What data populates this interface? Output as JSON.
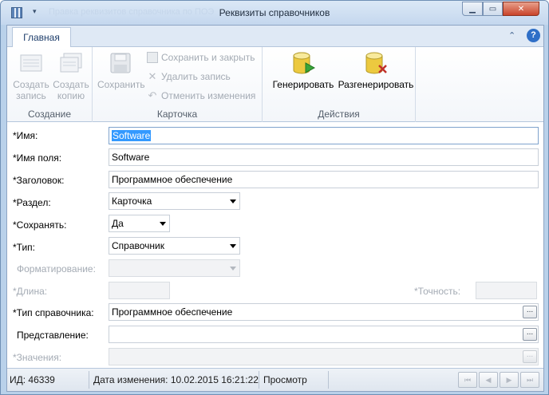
{
  "window": {
    "title": "Реквизиты справочников",
    "ghost_title": "Правка реквизитов справочника по ПОЭ"
  },
  "ribbon": {
    "tabs": [
      "Главная"
    ],
    "groups": {
      "create": {
        "label": "Создание",
        "buttons": [
          "Создать запись",
          "Создать копию"
        ]
      },
      "card": {
        "label": "Карточка",
        "save": "Сохранить",
        "save_close": "Сохранить и закрыть",
        "delete": "Удалить запись",
        "cancel": "Отменить изменения"
      },
      "actions": {
        "label": "Действия",
        "generate": "Генерировать",
        "regenerate": "Разгенерировать"
      }
    }
  },
  "form": {
    "name": {
      "label": "*Имя:",
      "value": "Software"
    },
    "field_name": {
      "label": "*Имя поля:",
      "value": "Software"
    },
    "heading": {
      "label": "*Заголовок:",
      "value": "Программное обеспечение"
    },
    "section": {
      "label": "*Раздел:",
      "value": "Карточка"
    },
    "save": {
      "label": "*Сохранять:",
      "value": "Да"
    },
    "type": {
      "label": "*Тип:",
      "value": "Справочник"
    },
    "format": {
      "label": "Форматирование:",
      "value": ""
    },
    "length": {
      "label": "*Длина:",
      "value": ""
    },
    "precision": {
      "label": "*Точность:",
      "value": ""
    },
    "ref_type": {
      "label": "*Тип справочника:",
      "value": "Программное обеспечение"
    },
    "view": {
      "label": "Представление:",
      "value": ""
    },
    "values": {
      "label": "*Значения:",
      "value": ""
    },
    "ellipsis": "..."
  },
  "status": {
    "id": "ИД: 46339",
    "modified": "Дата изменения: 10.02.2015 16:21:22",
    "mode": "Просмотр"
  }
}
